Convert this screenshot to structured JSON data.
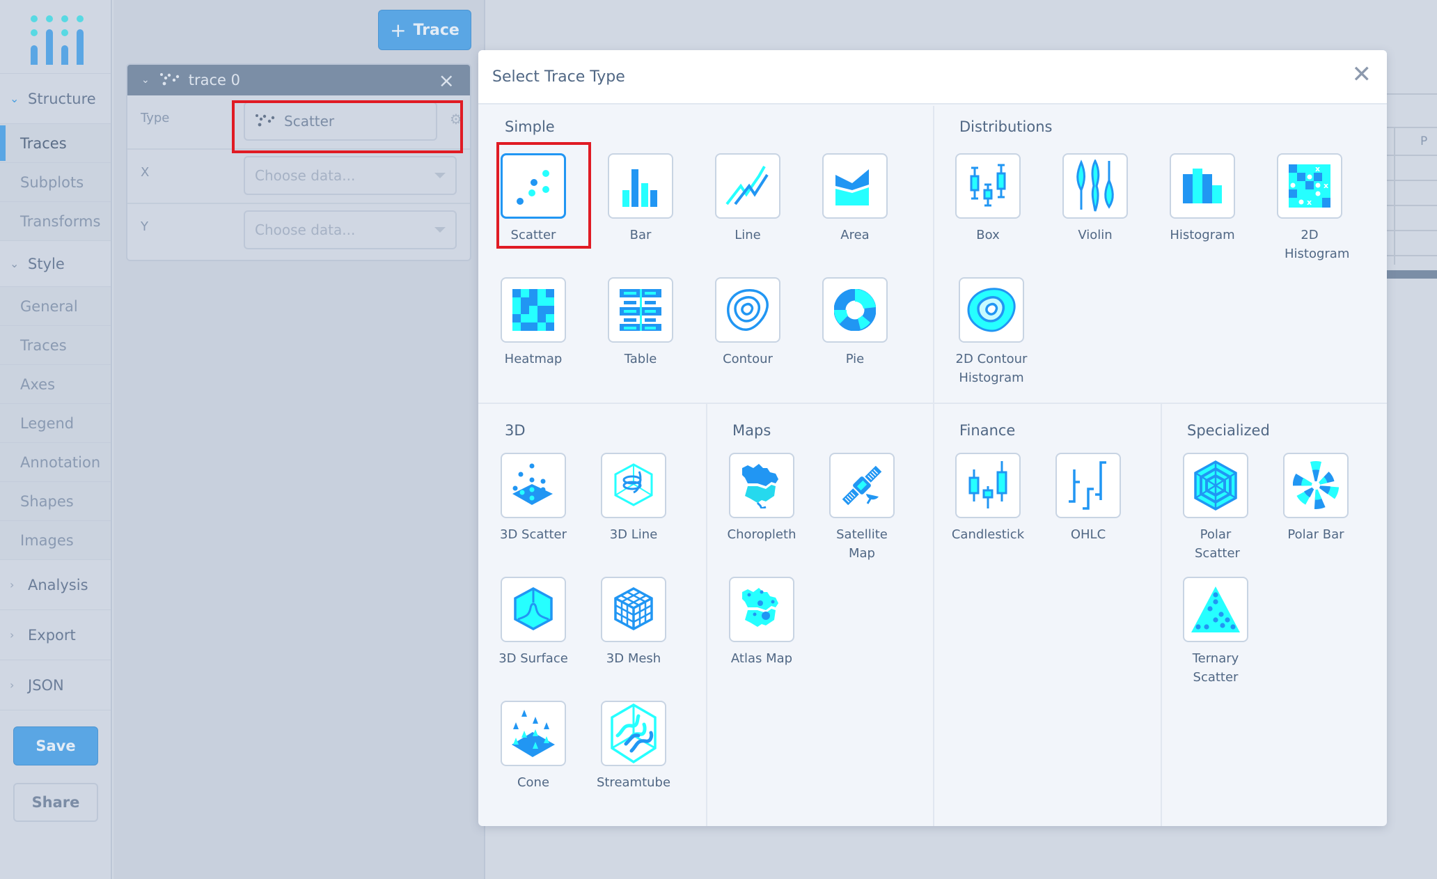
{
  "app": {
    "logo_icon": "plotly-logo-icon",
    "brand_colors": {
      "accent": "#5aa6e4",
      "logo_cyan": "#58d9e3",
      "icon_blue": "#2196f3",
      "icon_cyan": "#26ffff",
      "highlight_red": "#e01b24"
    }
  },
  "sidebar": {
    "groups": [
      {
        "label": "Structure",
        "state": "expanded",
        "items": [
          {
            "label": "Traces",
            "active": true
          },
          {
            "label": "Subplots",
            "active": false
          },
          {
            "label": "Transforms",
            "active": false
          }
        ]
      },
      {
        "label": "Style",
        "state": "expanded",
        "items": [
          {
            "label": "General"
          },
          {
            "label": "Traces"
          },
          {
            "label": "Axes"
          },
          {
            "label": "Legend"
          },
          {
            "label": "Annotation"
          },
          {
            "label": "Shapes"
          },
          {
            "label": "Images"
          }
        ]
      },
      {
        "label": "Analysis",
        "state": "collapsed"
      },
      {
        "label": "Export",
        "state": "collapsed"
      },
      {
        "label": "JSON",
        "state": "collapsed"
      }
    ],
    "save_label": "Save",
    "share_label": "Share"
  },
  "panel": {
    "add_trace_label": "Trace",
    "add_trace_icon": "plus-icon",
    "trace": {
      "name": "trace 0",
      "icon": "scatter-icon",
      "fields": {
        "type_label": "Type",
        "type_value": "Scatter",
        "x_label": "X",
        "x_placeholder": "Choose data...",
        "y_label": "Y",
        "y_placeholder": "Choose data..."
      }
    }
  },
  "background_sheet": {
    "column_header": "P"
  },
  "modal": {
    "title": "Select Trace Type",
    "close_icon": "close-icon",
    "selected": "Scatter",
    "sections": [
      {
        "title": "Simple",
        "items": [
          {
            "label": "Scatter",
            "icon": "scatter-icon"
          },
          {
            "label": "Bar",
            "icon": "bar-icon"
          },
          {
            "label": "Line",
            "icon": "line-icon"
          },
          {
            "label": "Area",
            "icon": "area-icon"
          },
          {
            "label": "Heatmap",
            "icon": "heatmap-icon"
          },
          {
            "label": "Table",
            "icon": "table-icon"
          },
          {
            "label": "Contour",
            "icon": "contour-icon"
          },
          {
            "label": "Pie",
            "icon": "pie-icon"
          }
        ]
      },
      {
        "title": "Distributions",
        "items": [
          {
            "label": "Box",
            "icon": "box-icon"
          },
          {
            "label": "Violin",
            "icon": "violin-icon"
          },
          {
            "label": "Histogram",
            "icon": "histogram-icon"
          },
          {
            "label": "2D Histogram",
            "icon": "2d-histogram-icon"
          },
          {
            "label": "2D Contour Histogram",
            "icon": "2d-contour-histogram-icon"
          }
        ]
      },
      {
        "title": "3D",
        "items": [
          {
            "label": "3D Scatter",
            "icon": "3d-scatter-icon"
          },
          {
            "label": "3D Line",
            "icon": "3d-line-icon"
          },
          {
            "label": "3D Surface",
            "icon": "3d-surface-icon"
          },
          {
            "label": "3D Mesh",
            "icon": "3d-mesh-icon"
          },
          {
            "label": "Cone",
            "icon": "cone-icon"
          },
          {
            "label": "Streamtube",
            "icon": "streamtube-icon"
          }
        ]
      },
      {
        "title": "Maps",
        "items": [
          {
            "label": "Choropleth",
            "icon": "choropleth-icon"
          },
          {
            "label": "Satellite Map",
            "icon": "satellite-map-icon"
          },
          {
            "label": "Atlas Map",
            "icon": "atlas-map-icon"
          }
        ]
      },
      {
        "title": "Finance",
        "items": [
          {
            "label": "Candlestick",
            "icon": "candlestick-icon"
          },
          {
            "label": "OHLC",
            "icon": "ohlc-icon"
          }
        ]
      },
      {
        "title": "Specialized",
        "items": [
          {
            "label": "Polar Scatter",
            "icon": "polar-scatter-icon"
          },
          {
            "label": "Polar Bar",
            "icon": "polar-bar-icon"
          },
          {
            "label": "Ternary Scatter",
            "icon": "ternary-scatter-icon"
          }
        ]
      }
    ]
  }
}
